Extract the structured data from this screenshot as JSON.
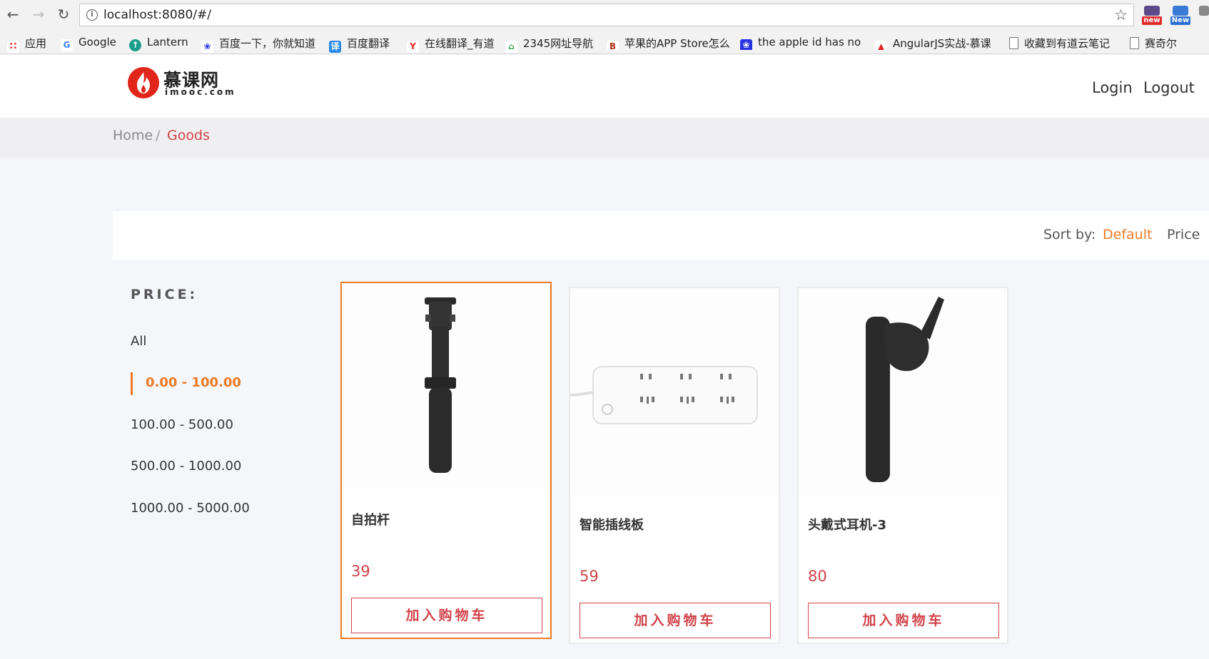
{
  "browser": {
    "url": "localhost:8080/#/",
    "ext1_label": "new",
    "ext2_label": "New",
    "bookmarks": [
      {
        "label": "应用"
      },
      {
        "label": "Google"
      },
      {
        "label": "Lantern"
      },
      {
        "label": "百度一下，你就知道"
      },
      {
        "label": "百度翻译"
      },
      {
        "label": "在线翻译_有道"
      },
      {
        "label": "2345网址导航"
      },
      {
        "label": "苹果的APP Store怎么"
      },
      {
        "label": "the apple id has no"
      },
      {
        "label": "AngularJS实战-慕课"
      },
      {
        "label": "收藏到有道云笔记"
      },
      {
        "label": "赛奇尔"
      }
    ]
  },
  "header": {
    "brand": "慕课网",
    "brand_sub": "imooc.com",
    "login": "Login",
    "logout": "Logout"
  },
  "breadcrumb": {
    "home": "Home",
    "separator": "/",
    "current": "Goods"
  },
  "sort": {
    "label": "Sort by:",
    "default": "Default",
    "price": "Price"
  },
  "filter": {
    "title": "PRICE:",
    "options": [
      "All",
      "0.00 - 100.00",
      "100.00 - 500.00",
      "500.00 - 1000.00",
      "1000.00 - 5000.00"
    ],
    "active_index": 1
  },
  "products": [
    {
      "name": "自拍杆",
      "price": "39",
      "button": "加入购物车",
      "icon": "selfie-stick"
    },
    {
      "name": "智能插线板",
      "price": "59",
      "button": "加入购物车",
      "icon": "power-strip"
    },
    {
      "name": "头戴式耳机-3",
      "price": "80",
      "button": "加入购物车",
      "icon": "bluetooth-headset"
    }
  ],
  "colors": {
    "accent_orange": "#ee7a23",
    "price_red": "#d1434a",
    "logo_red": "#e1251b"
  }
}
